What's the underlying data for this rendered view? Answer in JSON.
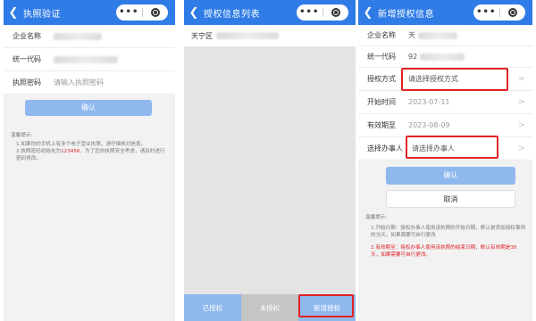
{
  "screen1": {
    "title": "执照验证",
    "fields": [
      {
        "label": "企业名称",
        "value": ""
      },
      {
        "label": "统一代码",
        "value": ""
      },
      {
        "label": "执照密码",
        "value": "请输入执照密码"
      }
    ],
    "confirm_label": "确认",
    "tips_title": "温馨提示:",
    "tip1": "1.如果你的手机上有多个电子营业执照，请仔细核对信息。",
    "tip2_pre": "2.执照密码初始化为",
    "tip2_code": "123456",
    "tip2_post": "，为了您的执照安全考虑，请及时进行密码修改。"
  },
  "screen2": {
    "title": "授权信息列表",
    "list_item_prefix": "天宁区",
    "tabs": {
      "authorized": "已授权",
      "unauthorized": "未授权",
      "add": "新增授权"
    }
  },
  "screen3": {
    "title": "新增授权信息",
    "name_label": "企业名称",
    "name_value": "天",
    "code_label": "统一代码",
    "code_value": "92",
    "method_label": "授权方式",
    "method_placeholder": "请选择授权方式",
    "start_label": "开始时间",
    "start_value": "2023-07-11",
    "valid_label": "有效期至",
    "valid_value": "2023-08-09",
    "agent_label": "选择办事人",
    "agent_placeholder": "请选择办事人",
    "confirm_label": "确认",
    "cancel_label": "取消",
    "tips_title": "温馨提示:",
    "tip1": "1.开始日期：授权办事人使用该执照的开始日期，默认是添加授权事项的当天，如果需要可自行更改",
    "tip2": "2.有效期至：授权办事人使用该执照的结束日期，默认有效期是30天，如果需要可自行更改。"
  },
  "colors": {
    "navbar": "#2f7ce6",
    "button": "#8fb8ee",
    "highlight": "#e02424",
    "tab_active": "#8fb8ee",
    "tab_inactive": "#c5c5c5"
  }
}
